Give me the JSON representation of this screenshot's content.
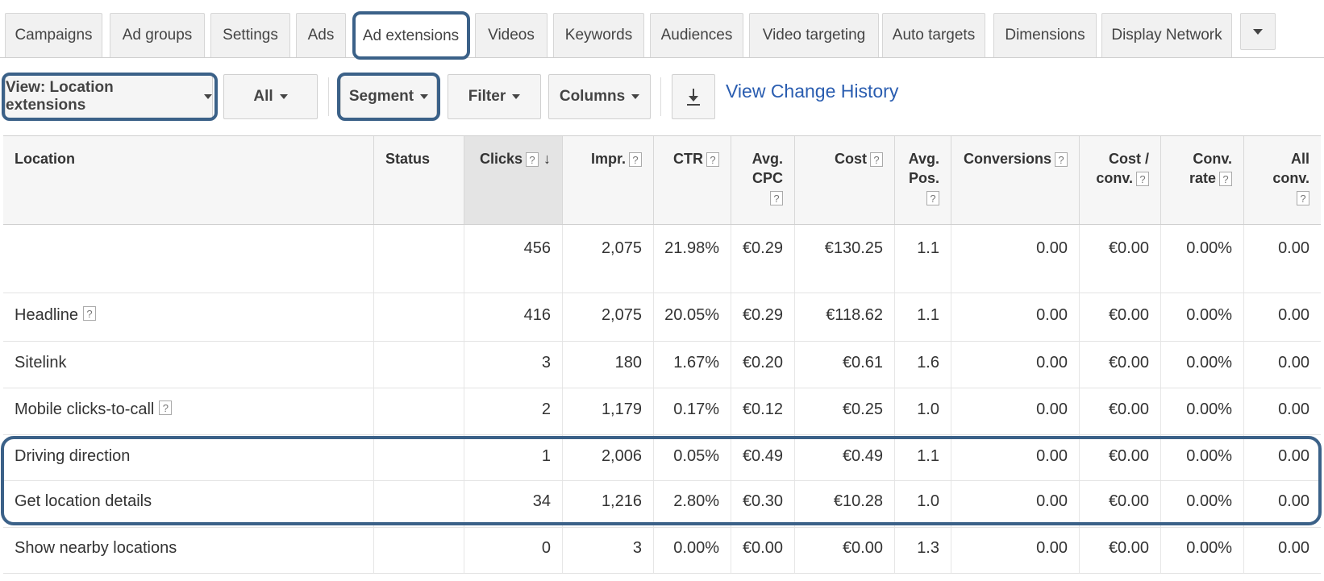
{
  "tabs": [
    {
      "label": "Campaigns",
      "active": false
    },
    {
      "label": "Ad groups",
      "active": false
    },
    {
      "label": "Settings",
      "active": false
    },
    {
      "label": "Ads",
      "active": false
    },
    {
      "label": "Ad extensions",
      "active": true
    },
    {
      "label": "Videos",
      "active": false
    },
    {
      "label": "Keywords",
      "active": false
    },
    {
      "label": "Audiences",
      "active": false
    },
    {
      "label": "Video targeting",
      "active": false
    },
    {
      "label": "Auto targets",
      "active": false
    },
    {
      "label": "Dimensions",
      "active": false
    },
    {
      "label": "Display Network",
      "active": false
    }
  ],
  "toolbar": {
    "view_label": "View: Location extensions",
    "all_label": "All",
    "segment_label": "Segment",
    "filter_label": "Filter",
    "columns_label": "Columns",
    "change_history_link": "View Change History"
  },
  "table": {
    "headers": {
      "location": "Location",
      "status": "Status",
      "clicks": "Clicks",
      "impr": "Impr.",
      "ctr": "CTR",
      "avg_cpc_1": "Avg.",
      "avg_cpc_2": "CPC",
      "cost": "Cost",
      "avg_pos_1": "Avg.",
      "avg_pos_2": "Pos.",
      "conversions": "Conversions",
      "cost_conv_1": "Cost /",
      "cost_conv_2": "conv.",
      "conv_rate_1": "Conv.",
      "conv_rate_2": "rate",
      "all_conv_1": "All",
      "all_conv_2": "conv."
    },
    "total": {
      "location": "",
      "status": "",
      "clicks": "456",
      "impr": "2,075",
      "ctr": "21.98%",
      "avg_cpc": "€0.29",
      "cost": "€130.25",
      "avg_pos": "1.1",
      "conversions": "0.00",
      "cost_conv": "€0.00",
      "conv_rate": "0.00%",
      "all_conv": "0.00"
    },
    "rows": [
      {
        "location": "Headline",
        "help": true,
        "status": "",
        "clicks": "416",
        "impr": "2,075",
        "ctr": "20.05%",
        "avg_cpc": "€0.29",
        "cost": "€118.62",
        "avg_pos": "1.1",
        "conversions": "0.00",
        "cost_conv": "€0.00",
        "conv_rate": "0.00%",
        "all_conv": "0.00"
      },
      {
        "location": "Sitelink",
        "help": false,
        "status": "",
        "clicks": "3",
        "impr": "180",
        "ctr": "1.67%",
        "avg_cpc": "€0.20",
        "cost": "€0.61",
        "avg_pos": "1.6",
        "conversions": "0.00",
        "cost_conv": "€0.00",
        "conv_rate": "0.00%",
        "all_conv": "0.00"
      },
      {
        "location": "Mobile clicks-to-call",
        "help": true,
        "status": "",
        "clicks": "2",
        "impr": "1,179",
        "ctr": "0.17%",
        "avg_cpc": "€0.12",
        "cost": "€0.25",
        "avg_pos": "1.0",
        "conversions": "0.00",
        "cost_conv": "€0.00",
        "conv_rate": "0.00%",
        "all_conv": "0.00"
      },
      {
        "location": "Driving direction",
        "help": false,
        "status": "",
        "clicks": "1",
        "impr": "2,006",
        "ctr": "0.05%",
        "avg_cpc": "€0.49",
        "cost": "€0.49",
        "avg_pos": "1.1",
        "conversions": "0.00",
        "cost_conv": "€0.00",
        "conv_rate": "0.00%",
        "all_conv": "0.00"
      },
      {
        "location": "Get location details",
        "help": false,
        "status": "",
        "clicks": "34",
        "impr": "1,216",
        "ctr": "2.80%",
        "avg_cpc": "€0.30",
        "cost": "€10.28",
        "avg_pos": "1.0",
        "conversions": "0.00",
        "cost_conv": "€0.00",
        "conv_rate": "0.00%",
        "all_conv": "0.00"
      },
      {
        "location": "Show nearby locations",
        "help": false,
        "status": "",
        "clicks": "0",
        "impr": "3",
        "ctr": "0.00%",
        "avg_cpc": "€0.00",
        "cost": "€0.00",
        "avg_pos": "1.3",
        "conversions": "0.00",
        "cost_conv": "€0.00",
        "conv_rate": "0.00%",
        "all_conv": "0.00"
      }
    ]
  },
  "colors": {
    "highlight": "#3b6188",
    "link": "#2a5db0"
  },
  "icons": {
    "tabs_more": "chevron-down-icon",
    "download": "download-icon",
    "sort": "sort-down-arrow-icon",
    "help": "help-icon"
  }
}
